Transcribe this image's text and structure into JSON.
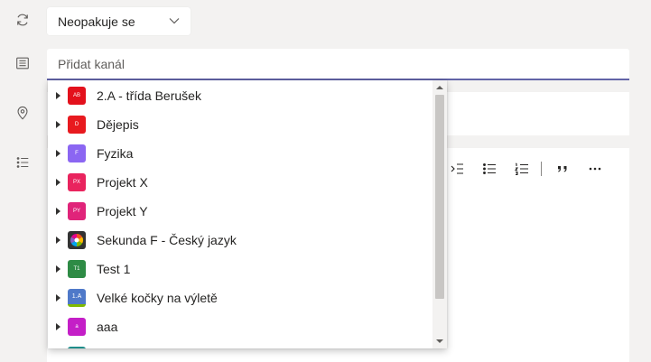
{
  "rail": {
    "icons": [
      "repeat-icon",
      "list-icon",
      "location-icon",
      "checklist-icon"
    ]
  },
  "repeat": {
    "value": "Neopakuje se"
  },
  "channel": {
    "placeholder": "Přidat kanál"
  },
  "colors": {
    "accent": "#6264a7",
    "scroll_thumb": "#c8c6c4"
  },
  "channels": [
    {
      "label": "2.A - třída Berušek",
      "avatar_text": "AB",
      "color": "#e3111c"
    },
    {
      "label": "Dějepis",
      "avatar_text": "D",
      "color": "#e81a1f"
    },
    {
      "label": "Fyzika",
      "avatar_text": "F",
      "color": "#8b66f2"
    },
    {
      "label": "Projekt X",
      "avatar_text": "PX",
      "color": "#e9245e"
    },
    {
      "label": "Projekt Y",
      "avatar_text": "PY",
      "color": "#e0247a"
    },
    {
      "label": "Sekunda F - Český jazyk",
      "avatar_text": "",
      "color": "#333333"
    },
    {
      "label": "Test 1",
      "avatar_text": "T1",
      "color": "#2e8b45"
    },
    {
      "label": "Velké kočky na výletě",
      "avatar_text": "1.A",
      "color": "#4f79c9"
    },
    {
      "label": "aaa",
      "avatar_text": "a",
      "color": "#c41fc7"
    },
    {
      "label": "",
      "avatar_text": "",
      "color": "#1f8d8a"
    }
  ]
}
